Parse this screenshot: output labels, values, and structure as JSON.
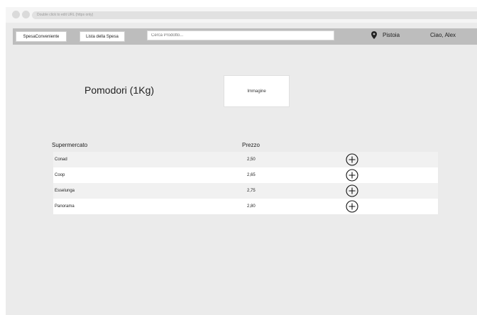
{
  "browser": {
    "url_hint": "Double click to edit URL (https only)"
  },
  "navbar": {
    "brand_label": "SpesaConveniente",
    "shopping_list_label": "Lista della Spesa",
    "search_placeholder": "Cerca Prodotto...",
    "location": "Pistoia",
    "greeting": "Ciao, Alex",
    "location_icon": "map-pin-icon"
  },
  "product": {
    "name": "Pomodori (1Kg)",
    "image_placeholder": "Immagine"
  },
  "table": {
    "headers": [
      "Supermercato",
      "Prezzo"
    ],
    "rows": [
      {
        "store": "Conad",
        "price": "2,50"
      },
      {
        "store": "Coop",
        "price": "2,65"
      },
      {
        "store": "Esselunga",
        "price": "2,75"
      },
      {
        "store": "Panorama",
        "price": "2,80"
      }
    ],
    "add_icon": "plus-circle-icon"
  }
}
